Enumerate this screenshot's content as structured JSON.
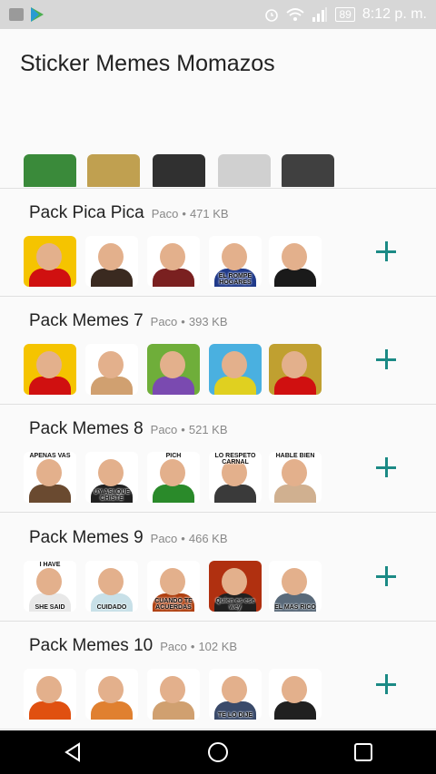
{
  "status_bar": {
    "time": "8:12 p. m.",
    "battery": "89"
  },
  "app": {
    "title": "Sticker Memes Momazos"
  },
  "partial_row": {
    "captions": [
      "",
      "",
      "",
      "",
      ""
    ]
  },
  "packs": [
    {
      "name": "Pack Pica Pica",
      "author": "Paco",
      "size": "471 KB",
      "stickers": [
        {
          "bg": "#f5c400",
          "body": "#d01010",
          "caption": ""
        },
        {
          "bg": "#ffffff",
          "body": "#3a2a20",
          "caption": ""
        },
        {
          "bg": "#ffffff",
          "body": "#7a2020",
          "caption": ""
        },
        {
          "bg": "#ffffff",
          "body": "#203a8a",
          "caption": "EL ROMPE HOGARES"
        },
        {
          "bg": "#ffffff",
          "body": "#1a1a1a",
          "caption": ""
        }
      ]
    },
    {
      "name": "Pack Memes 7",
      "author": "Paco",
      "size": "393 KB",
      "stickers": [
        {
          "bg": "#f5c400",
          "body": "#d01010",
          "caption": ""
        },
        {
          "bg": "#ffffff",
          "body": "#d0a070",
          "caption": ""
        },
        {
          "bg": "#6fae3a",
          "body": "#7a4ab0",
          "caption": ""
        },
        {
          "bg": "#4ab0e0",
          "body": "#e0d020",
          "caption": ""
        },
        {
          "bg": "#c0a030",
          "body": "#d01010",
          "caption": ""
        }
      ]
    },
    {
      "name": "Pack Memes 8",
      "author": "Paco",
      "size": "521 KB",
      "stickers": [
        {
          "bg": "#ffffff",
          "body": "#6a4a30",
          "caption": "",
          "top": "APENAS VAS"
        },
        {
          "bg": "#ffffff",
          "body": "#202020",
          "caption": "UY ASI QUE CHISTE"
        },
        {
          "bg": "#ffffff",
          "body": "#2a8a2a",
          "caption": "",
          "top": "PICH"
        },
        {
          "bg": "#ffffff",
          "body": "#3a3a3a",
          "caption": "",
          "top": "LO RESPETO CARNAL"
        },
        {
          "bg": "#ffffff",
          "body": "#d0b090",
          "caption": "",
          "top": "HABLE BIEN"
        }
      ]
    },
    {
      "name": "Pack Memes 9",
      "author": "Paco",
      "size": "466 KB",
      "stickers": [
        {
          "bg": "#ffffff",
          "body": "#e8e8e8",
          "caption": "SHE SAID",
          "top": "I HAVE"
        },
        {
          "bg": "#ffffff",
          "body": "#c8e0e8",
          "caption": "CUIDADO"
        },
        {
          "bg": "#ffffff",
          "body": "#b04010",
          "caption": "CUANDO TE ACUERDAS"
        },
        {
          "bg": "#b03010",
          "body": "#202020",
          "caption": "Quien es ese wey"
        },
        {
          "bg": "#ffffff",
          "body": "#5a6a7a",
          "caption": "EL MAS RICO"
        }
      ]
    },
    {
      "name": "Pack Memes 10",
      "author": "Paco",
      "size": "102 KB",
      "stickers": [
        {
          "bg": "#ffffff",
          "body": "#e05010",
          "caption": ""
        },
        {
          "bg": "#ffffff",
          "body": "#e08030",
          "caption": ""
        },
        {
          "bg": "#ffffff",
          "body": "#d0a070",
          "caption": ""
        },
        {
          "bg": "#ffffff",
          "body": "#3a4a6a",
          "caption": "TE LO DIJE"
        },
        {
          "bg": "#ffffff",
          "body": "#202020",
          "caption": ""
        }
      ]
    }
  ],
  "nav": {
    "back": "back",
    "home": "home",
    "recents": "recents"
  }
}
